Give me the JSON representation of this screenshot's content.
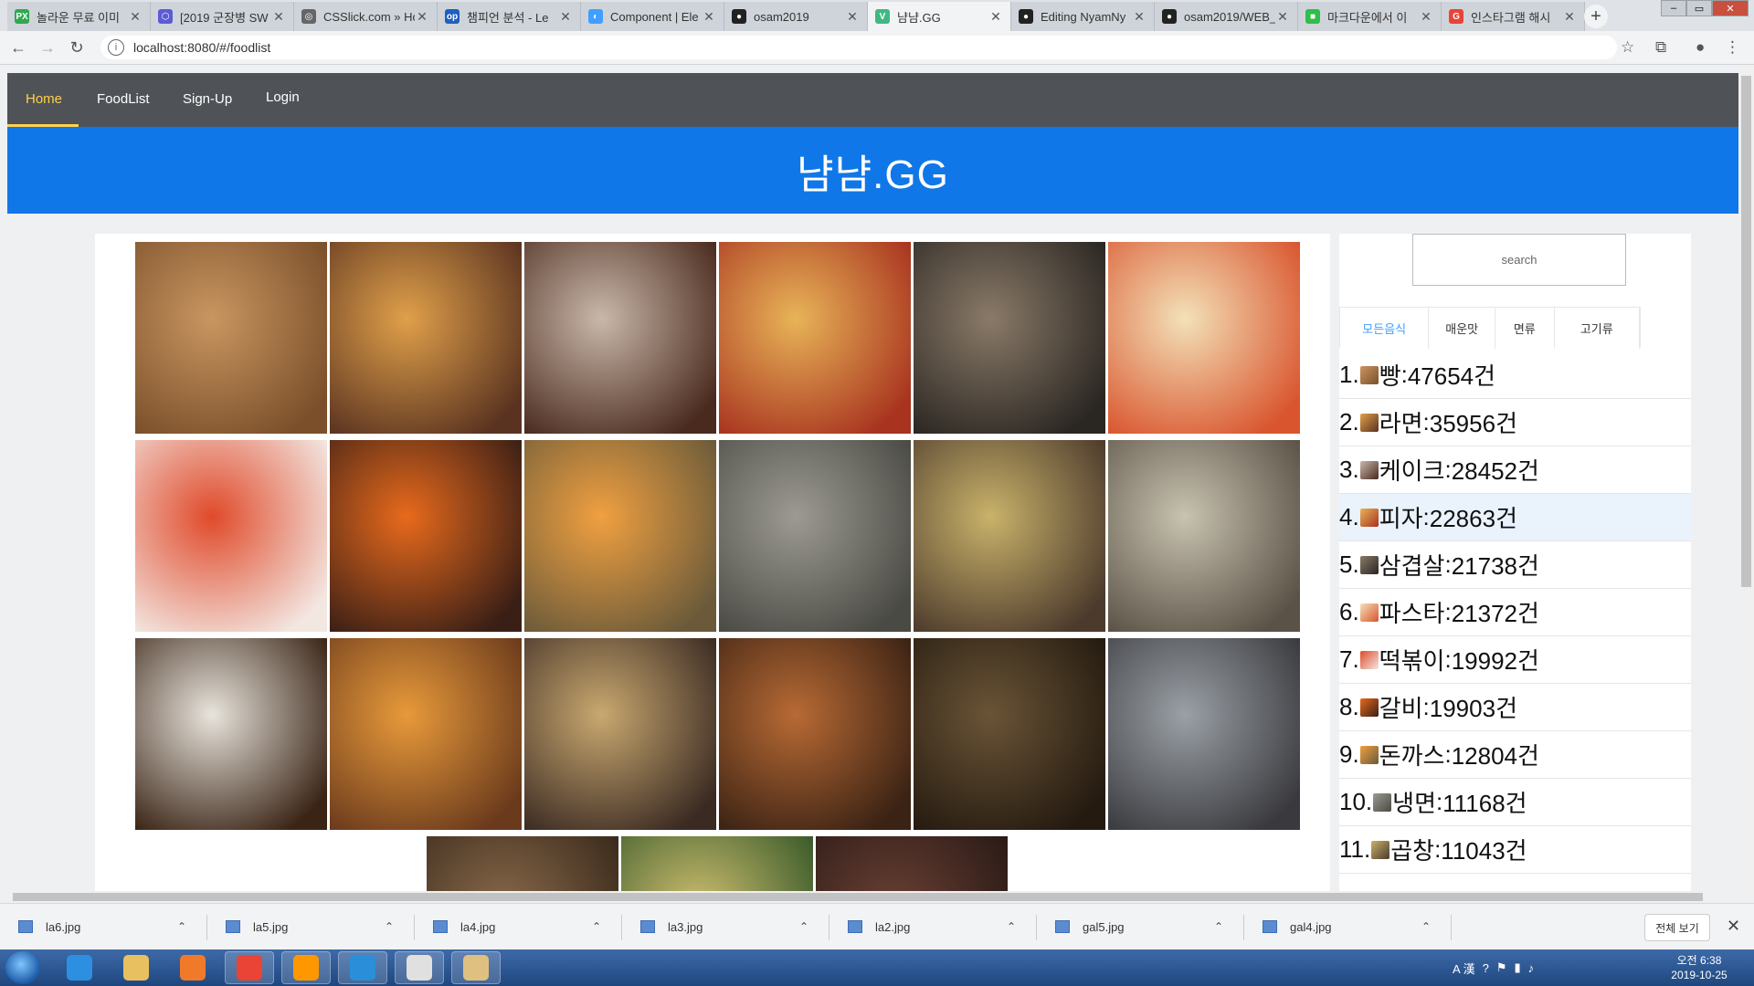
{
  "browser": {
    "tabs": [
      {
        "title": "놀라운 무료 이미",
        "favicon": "px-icon",
        "color": "#2fa84f",
        "glyph": "PX"
      },
      {
        "title": "[2019 군장병 SW",
        "favicon": "hexagon-icon",
        "color": "#5b5bd6",
        "glyph": "⬡"
      },
      {
        "title": "CSSlick.com » Ho",
        "favicon": "globe-icon",
        "color": "#666666",
        "glyph": "◎"
      },
      {
        "title": "챔피언 분석 - Le",
        "favicon": "opgg-icon",
        "color": "#1e5fbf",
        "glyph": "op"
      },
      {
        "title": "Component | Ele",
        "favicon": "element-icon",
        "color": "#409eff",
        "glyph": "◐"
      },
      {
        "title": "osam2019",
        "favicon": "github-icon",
        "color": "#222222",
        "glyph": "●"
      },
      {
        "title": "냠냠.GG",
        "favicon": "vue-icon",
        "color": "#41b883",
        "glyph": "V"
      },
      {
        "title": "Editing NyamNy",
        "favicon": "github-icon",
        "color": "#222222",
        "glyph": "●"
      },
      {
        "title": "osam2019/WEB_",
        "favicon": "github-icon",
        "color": "#222222",
        "glyph": "●"
      },
      {
        "title": "마크다운에서 이",
        "favicon": "line-icon",
        "color": "#2cbf4a",
        "glyph": "■"
      },
      {
        "title": "인스타그램 해시",
        "favicon": "google-icon",
        "color": "#ea4335",
        "glyph": "G"
      }
    ],
    "active_tab_index": 6,
    "url": "localhost:8080/#/foodlist"
  },
  "site": {
    "nav": [
      "Home",
      "FoodList",
      "Sign-Up",
      "Login"
    ],
    "active_nav": "Home",
    "brand_color": "#1077e8",
    "title": "냠냠.GG",
    "search_placeholder": "search",
    "categories": [
      "모든음식",
      "매운맛",
      "면류",
      "고기류"
    ],
    "active_category": "모든음식",
    "ranking": [
      {
        "label": "1.",
        "name": "빵",
        "count": "47654건"
      },
      {
        "label": "2.",
        "name": "라면",
        "count": "35956건"
      },
      {
        "label": "3.",
        "name": "케이크",
        "count": "28452건"
      },
      {
        "label": "4.",
        "name": "피자",
        "count": "22863건"
      },
      {
        "label": "5.",
        "name": "삼겹살",
        "count": "21738건"
      },
      {
        "label": "6.",
        "name": "파스타",
        "count": "21372건"
      },
      {
        "label": "7.",
        "name": "떡볶이",
        "count": "19992건"
      },
      {
        "label": "8.",
        "name": "갈비",
        "count": "19903건"
      },
      {
        "label": "9.",
        "name": "돈까스",
        "count": "12804건"
      },
      {
        "label": "10.",
        "name": "냉면",
        "count": "11168건"
      },
      {
        "label": "11.",
        "name": "곱창",
        "count": "11043건"
      }
    ],
    "highlighted_rank": 3,
    "gallery": [
      {
        "name": "bread",
        "c1": "#c99660",
        "c2": "#7a4f2a"
      },
      {
        "name": "ramen",
        "c1": "#e0a04a",
        "c2": "#5a3320"
      },
      {
        "name": "cake",
        "c1": "#c9b8aa",
        "c2": "#4a2a1e"
      },
      {
        "name": "pizza",
        "c1": "#e8b458",
        "c2": "#a8331f"
      },
      {
        "name": "samgyeopsal",
        "c1": "#8a7a68",
        "c2": "#2a2622"
      },
      {
        "name": "pasta",
        "c1": "#f3e1b8",
        "c2": "#d9552e"
      },
      {
        "name": "tteokbokki",
        "c1": "#e04a2a",
        "c2": "#f3e7e2"
      },
      {
        "name": "galbi",
        "c1": "#e86a1c",
        "c2": "#3a1f16"
      },
      {
        "name": "donkatsu",
        "c1": "#f0a040",
        "c2": "#6a5a3a"
      },
      {
        "name": "naengmyeon",
        "c1": "#9c9a92",
        "c2": "#4a4a44"
      },
      {
        "name": "gopchang",
        "c1": "#c9b26a",
        "c2": "#4c3a2c"
      },
      {
        "name": "noodle-soup",
        "c1": "#c8c2b0",
        "c2": "#5a5246"
      },
      {
        "name": "curry-rice",
        "c1": "#e8e4dc",
        "c2": "#3a2416"
      },
      {
        "name": "burger",
        "c1": "#e89a3a",
        "c2": "#6a3a1c"
      },
      {
        "name": "sundae",
        "c1": "#c9a870",
        "c2": "#3a2a22"
      },
      {
        "name": "octopus-bowl",
        "c1": "#b86a34",
        "c2": "#3a2214"
      },
      {
        "name": "jjajangmyeon",
        "c1": "#6a5436",
        "c2": "#241a10"
      },
      {
        "name": "hotpot",
        "c1": "#9aa0a6",
        "c2": "#3a3a3e"
      },
      {
        "name": "tea-table",
        "c1": "#8a6a4a",
        "c2": "#3a2a1c"
      },
      {
        "name": "side-dishes",
        "c1": "#d0c070",
        "c2": "#3a5a2a"
      },
      {
        "name": "bowls",
        "c1": "#6a4034",
        "c2": "#2a1a16"
      }
    ]
  },
  "downloads": {
    "items": [
      "la6.jpg",
      "la5.jpg",
      "la4.jpg",
      "la3.jpg",
      "la2.jpg",
      "gal5.jpg",
      "gal4.jpg"
    ],
    "show_all": "전체 보기"
  },
  "taskbar": {
    "apps": [
      {
        "name": "ie-icon",
        "color": "#2d8fe0"
      },
      {
        "name": "explorer-icon",
        "color": "#e8c060"
      },
      {
        "name": "media-player-icon",
        "color": "#f07a2a"
      },
      {
        "name": "chrome-icon",
        "color": "#e94435"
      },
      {
        "name": "sublime-icon",
        "color": "#ff9800"
      },
      {
        "name": "vscode-icon",
        "color": "#2a8fd8"
      },
      {
        "name": "notepad-icon",
        "color": "#e0e0e0"
      },
      {
        "name": "paint-icon",
        "color": "#e0c080"
      }
    ],
    "ime": "A 漢",
    "clock_time": "오전 6:38",
    "clock_date": "2019-10-25"
  }
}
